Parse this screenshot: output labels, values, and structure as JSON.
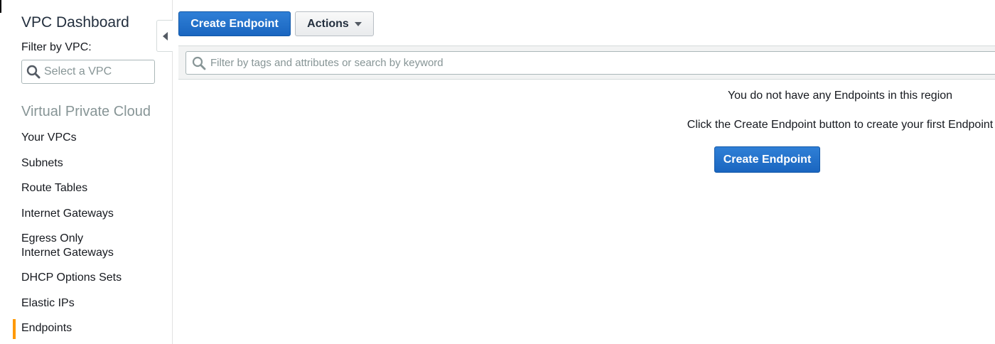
{
  "sidebar": {
    "title": "VPC Dashboard",
    "filter_label": "Filter by VPC:",
    "vpc_select_placeholder": "Select a VPC",
    "section_title": "Virtual Private Cloud",
    "items": [
      {
        "label": "Your VPCs"
      },
      {
        "label": "Subnets"
      },
      {
        "label": "Route Tables"
      },
      {
        "label": "Internet Gateways"
      },
      {
        "label": "Egress Only Internet Gateways"
      },
      {
        "label": "DHCP Options Sets"
      },
      {
        "label": "Elastic IPs"
      },
      {
        "label": "Endpoints",
        "active": true
      }
    ],
    "active_color": "#ff9900"
  },
  "toolbar": {
    "create_label": "Create Endpoint",
    "actions_label": "Actions"
  },
  "filter": {
    "placeholder": "Filter by tags and attributes or search by keyword"
  },
  "empty_state": {
    "line1": "You do not have any Endpoints in this region",
    "line2": "Click the Create Endpoint button to create your first Endpoint",
    "create_label": "Create Endpoint"
  },
  "icons": {
    "search": "search-icon",
    "collapse": "chevron-left-icon",
    "dropdown": "caret-down-icon"
  },
  "colors": {
    "primary_button": "#1a66c0",
    "accent": "#ff9900"
  }
}
